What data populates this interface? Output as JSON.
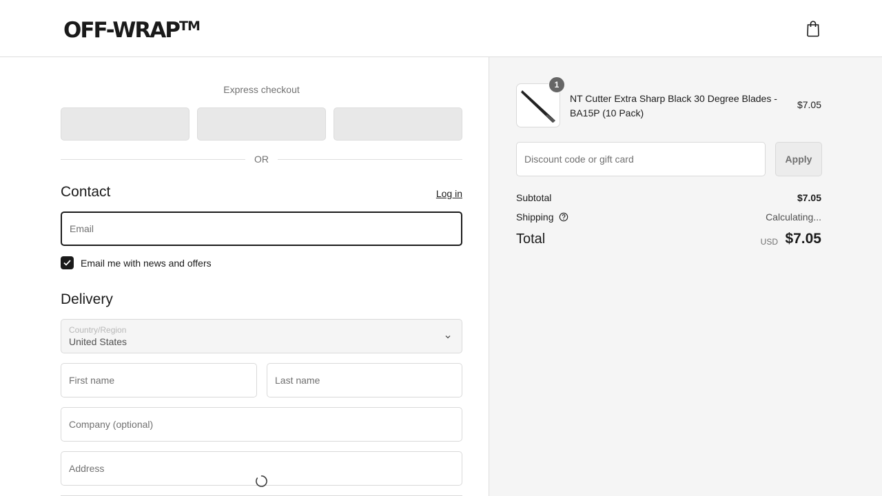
{
  "header": {
    "logo_text": "OFF-WRAP",
    "logo_mark": "TM",
    "cart_icon": "shopping-bag-icon"
  },
  "express": {
    "title": "Express checkout",
    "divider_text": "OR"
  },
  "contact": {
    "title": "Contact",
    "login_label": "Log in",
    "email_placeholder": "Email",
    "newsletter_label": "Email me with news and offers",
    "newsletter_checked": true
  },
  "delivery": {
    "title": "Delivery",
    "country_label": "Country/Region",
    "country_value": "United States",
    "first_name_placeholder": "First name",
    "last_name_placeholder": "Last name",
    "company_placeholder": "Company (optional)",
    "address_placeholder": "Address"
  },
  "order": {
    "items": [
      {
        "name": "NT Cutter Extra Sharp Black 30 Degree Blades - BA15P (10 Pack)",
        "quantity": "1",
        "price": "$7.05"
      }
    ],
    "discount_placeholder": "Discount code or gift card",
    "apply_label": "Apply",
    "subtotal_label": "Subtotal",
    "subtotal_value": "$7.05",
    "shipping_label": "Shipping",
    "shipping_value": "Calculating...",
    "total_label": "Total",
    "total_currency": "USD",
    "total_value": "$7.05"
  },
  "colors": {
    "accent": "#1a1a1a",
    "sidebar_bg": "#f5f5f5",
    "express_btn": "#e8e8e8"
  }
}
